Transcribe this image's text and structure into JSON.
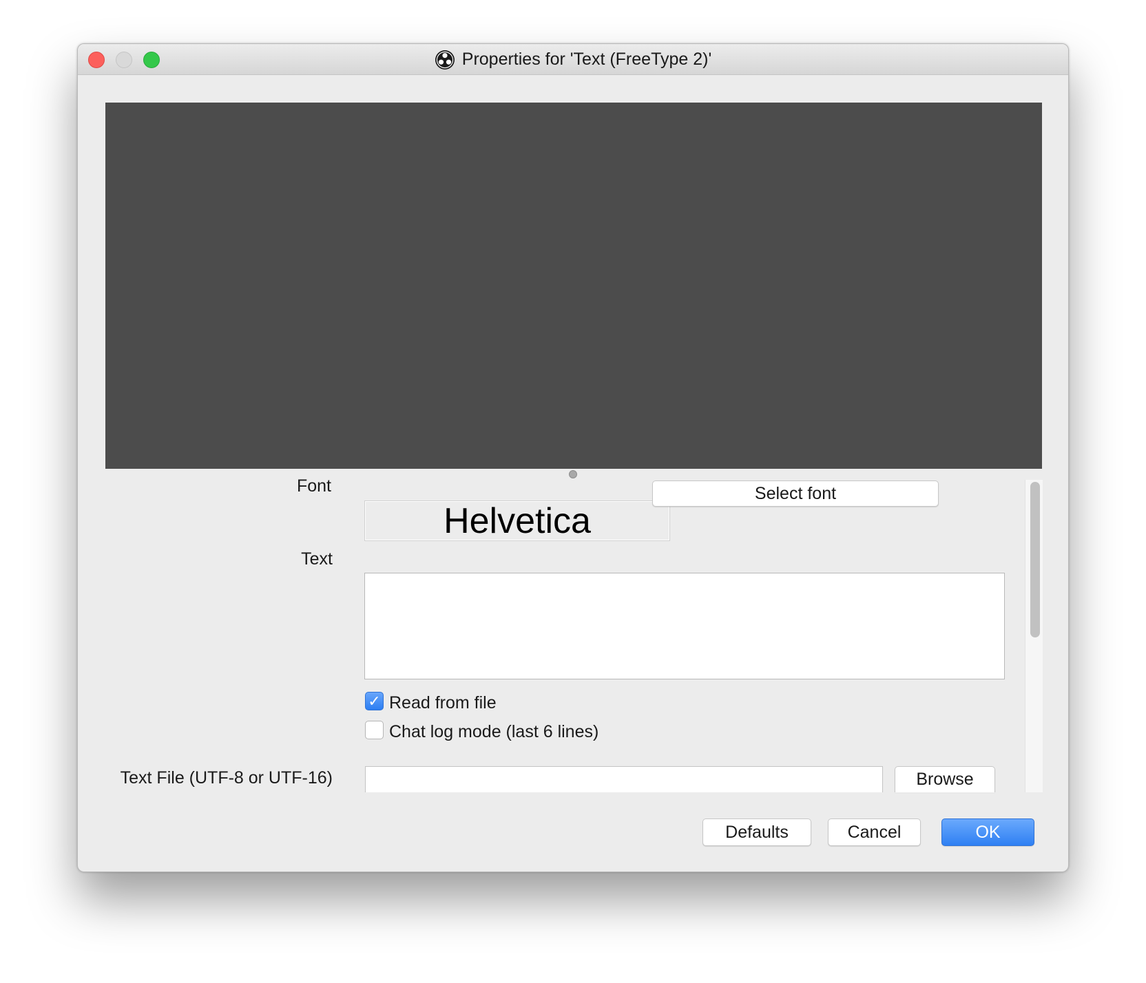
{
  "window": {
    "title": "Properties for 'Text (FreeType 2)'",
    "app_icon": "obs-logo-icon"
  },
  "font": {
    "label": "Font",
    "preview_name": "Helvetica",
    "select_label": "Select font"
  },
  "text": {
    "label": "Text",
    "value": ""
  },
  "options": {
    "read_from_file": {
      "label": "Read from file",
      "checked": true
    },
    "chat_log": {
      "label": "Chat log mode (last 6 lines)",
      "checked": false
    }
  },
  "text_file": {
    "label": "Text File (UTF-8 or UTF-16)",
    "value": "",
    "browse_label": "Browse"
  },
  "footer": {
    "defaults_label": "Defaults",
    "cancel_label": "Cancel",
    "ok_label": "OK"
  },
  "colors": {
    "preview_bg": "#4c4c4c",
    "accent": "#2f80f3",
    "window_bg": "#ececec"
  }
}
